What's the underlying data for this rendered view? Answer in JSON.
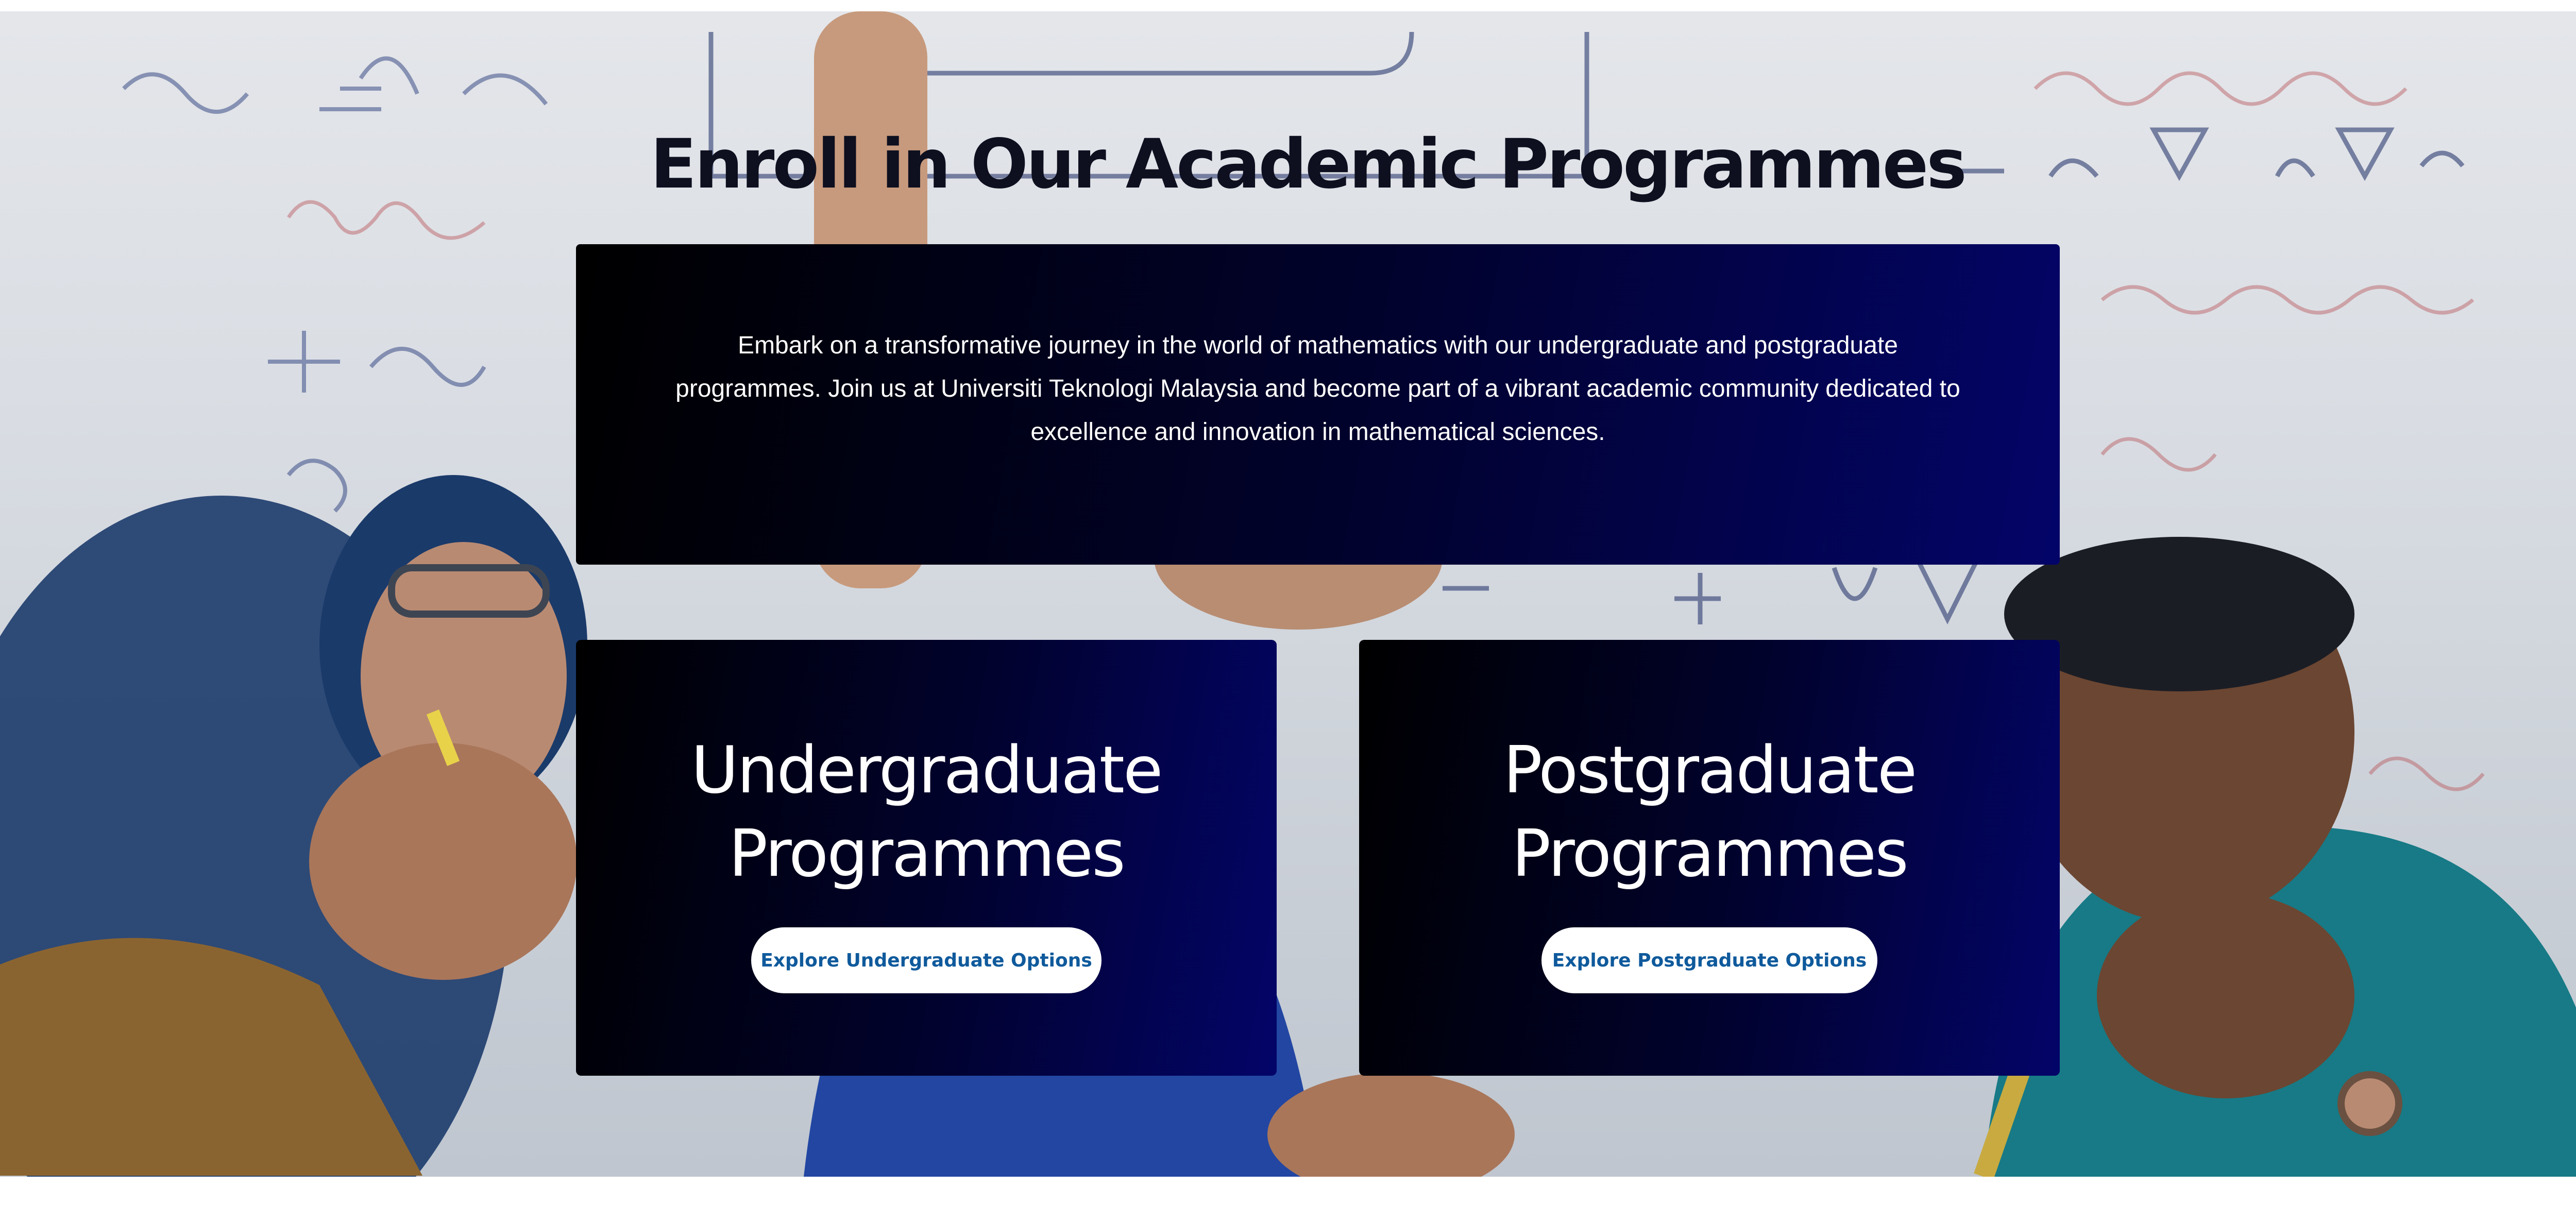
{
  "hero": {
    "title": "Enroll in Our Academic Programmes",
    "intro": "Embark on a transformative journey in the world of mathematics with our undergraduate and postgraduate programmes. Join us at Universiti Teknologi Malaysia and become part of a vibrant academic community dedicated to excellence and innovation in mathematical sciences.",
    "background_image": "students-at-whiteboard-photo"
  },
  "cards": {
    "undergraduate": {
      "title": "Undergraduate Programmes",
      "button_label": "Explore Undergraduate Options"
    },
    "postgraduate": {
      "title": "Postgraduate Programmes",
      "button_label": "Explore Postgraduate Options"
    }
  },
  "colors": {
    "card_gradient_start": "#000000",
    "card_gradient_end": "#030468",
    "title_color": "#0e0f1f",
    "button_text": "#0f5a9c",
    "button_bg": "#ffffff"
  }
}
